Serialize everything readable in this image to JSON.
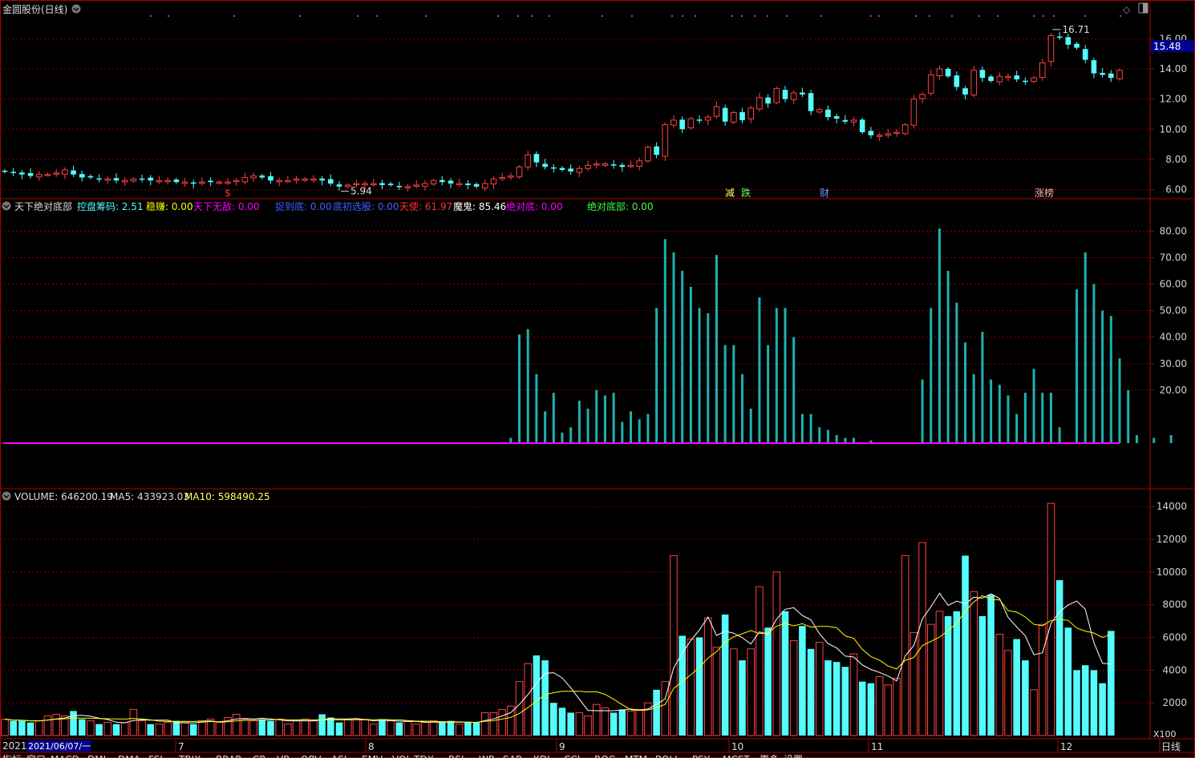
{
  "colors": {
    "up": "#ff4040",
    "down": "#54fcfc",
    "grid": "#8b0000",
    "border": "#b00000",
    "axis_text": "#d0d0d0",
    "line_ma5": "#ffffff",
    "line_ma10": "#ffff00",
    "base_line": "#ff00ff",
    "teal_bar": "#1eb1b1"
  },
  "header": {
    "stock": "金圆股份",
    "period": "(日线)",
    "current_price": "15.48",
    "diamond_icon": "◇"
  },
  "main_panel": {
    "yticks": [
      "16.00",
      "14.00",
      "12.00",
      "10.00",
      "8.00",
      "6.00"
    ],
    "high_label": "16.71",
    "low_label": "5.94",
    "markers": [
      {
        "text": "$",
        "x": 284,
        "color": "#ff3333"
      },
      {
        "text": "减",
        "x": 910,
        "color": "#ffff66"
      },
      {
        "text": "跌",
        "x": 930,
        "color": "#66ff66"
      },
      {
        "text": "财",
        "x": 1028,
        "color": "#6699ff"
      },
      {
        "text": "涨榜",
        "x": 1302,
        "color": "#ffaaaa"
      }
    ]
  },
  "indicator_panel": {
    "title": "天下绝对底部",
    "items": [
      {
        "name": "控盘筹码",
        "value": "2.51",
        "color": "#54fcfc"
      },
      {
        "name": "稳赚",
        "value": "0.00",
        "color": "#ffff00"
      },
      {
        "name": "天下无敌",
        "value": "0.00",
        "color": "#ff00ff"
      },
      {
        "name": "捉到底",
        "value": "0.00",
        "color": "#4060ff"
      },
      {
        "name": "底初选股",
        "value": "0.00",
        "color": "#4060ff"
      },
      {
        "name": "天使",
        "value": "61.97",
        "color": "#ff3030"
      },
      {
        "name": "魔鬼",
        "value": "85.46",
        "color": "#ffffff"
      },
      {
        "name": "绝对底",
        "value": "0.00",
        "color": "#ff00ff"
      },
      {
        "name": "绝对底部",
        "value": "0.00",
        "color": "#40ff40"
      }
    ],
    "yticks": [
      "80.00",
      "70.00",
      "60.00",
      "50.00",
      "40.00",
      "30.00",
      "20.00"
    ]
  },
  "volume_panel": {
    "label": "VOLUME",
    "value": "646200.19",
    "ma5_label": "MA5",
    "ma5_value": "433923.03",
    "ma10_label": "MA10",
    "ma10_value": "598490.25",
    "yticks": [
      "14000",
      "12000",
      "10000",
      "8000",
      "6000",
      "4000",
      "2000"
    ],
    "unit": "X100"
  },
  "time_axis": {
    "labels": [
      "2021",
      "2021/06/07/一",
      "7",
      "8",
      "9",
      "10",
      "11",
      "12"
    ],
    "period_label": "日线"
  },
  "bottom_tabs": [
    "指标",
    "窗口",
    "MACD",
    "DMI",
    "DMA",
    "FSL",
    "TRIX",
    "BRAR",
    "CR",
    "VR",
    "OBV",
    "ASI",
    "EMV",
    "VOL-TDX",
    "RSI",
    "WR",
    "SAR",
    "KDJ",
    "CCI",
    "ROC",
    "MTM",
    "BOLL",
    "PSY",
    "MCST",
    "更多",
    "设置"
  ],
  "chart_data": [
    {
      "type": "candlestick",
      "title": "金圆股份(日线)",
      "x": [
        "2021-06-07",
        "2021-07",
        "2021-08",
        "2021-09",
        "2021-10",
        "2021-11",
        "2021-12"
      ],
      "ylim": [
        5.5,
        17.5
      ],
      "close": [
        7.2,
        7.1,
        7.0,
        6.9,
        7.0,
        7.0,
        7.1,
        7.3,
        7.0,
        6.8,
        6.8,
        6.7,
        6.7,
        6.6,
        6.6,
        6.7,
        6.7,
        6.6,
        6.6,
        6.6,
        6.5,
        6.5,
        6.4,
        6.5,
        6.5,
        6.5,
        6.5,
        6.6,
        6.8,
        6.9,
        6.8,
        6.6,
        6.6,
        6.6,
        6.7,
        6.7,
        6.7,
        6.6,
        6.4,
        6.2,
        6.3,
        6.4,
        6.4,
        6.4,
        6.3,
        6.3,
        6.2,
        6.2,
        6.3,
        6.4,
        6.6,
        6.5,
        6.4,
        6.4,
        6.3,
        6.2,
        6.4,
        6.7,
        6.8,
        6.9,
        7.5,
        8.3,
        7.8,
        7.5,
        7.4,
        7.3,
        7.2,
        7.4,
        7.6,
        7.7,
        7.7,
        7.6,
        7.5,
        7.6,
        7.9,
        8.8,
        8.3,
        10.3,
        10.6,
        10.0,
        10.7,
        10.6,
        10.8,
        11.5,
        10.5,
        11.1,
        10.6,
        11.4,
        12.1,
        11.7,
        12.7,
        12.0,
        12.4,
        12.3,
        11.2,
        11.3,
        10.8,
        10.7,
        10.5,
        10.6,
        9.8,
        9.6,
        9.6,
        9.7,
        9.8,
        10.3,
        12.0,
        12.3,
        13.6,
        14.0,
        13.5,
        12.8,
        12.3,
        13.9,
        13.4,
        13.2,
        13.5,
        13.5,
        13.3,
        13.2,
        13.4,
        14.4,
        16.2,
        16.1,
        15.6,
        15.4,
        14.6,
        13.7,
        13.6,
        13.4,
        13.9
      ],
      "note": "closing prices read from the candlestick chart"
    },
    {
      "type": "bar",
      "title": "天下绝对底部",
      "ylim": [
        0,
        88
      ],
      "values": [
        0,
        0,
        0,
        0,
        0,
        0,
        0,
        0,
        0,
        0,
        0,
        0,
        0,
        0,
        0,
        0,
        0,
        0,
        0,
        0,
        0,
        0,
        0,
        0,
        0,
        0,
        0,
        0,
        0,
        0,
        0,
        0,
        0,
        0,
        0,
        0,
        0,
        0,
        0,
        0,
        0,
        0,
        0,
        0,
        0,
        0,
        0,
        0,
        0,
        0,
        0,
        0,
        0,
        0,
        0,
        0,
        0,
        0,
        0,
        2,
        41,
        43,
        26,
        12,
        19,
        4,
        6,
        16,
        13,
        20,
        18,
        19,
        8,
        12,
        9,
        11,
        51,
        77,
        72,
        65,
        59,
        51,
        49,
        71,
        37,
        37,
        26,
        13,
        55,
        37,
        51,
        51,
        40,
        11,
        11,
        6,
        5,
        3,
        2,
        2,
        0,
        1,
        0,
        0,
        0,
        0,
        0,
        24,
        51,
        81,
        65,
        53,
        38,
        26,
        42,
        24,
        22,
        18,
        11,
        19,
        28,
        19,
        19,
        6,
        0,
        58,
        72,
        60,
        50,
        48,
        32,
        20,
        3,
        0,
        2,
        0,
        3
      ],
      "note": "teal bars above the magenta baseline"
    },
    {
      "type": "bar",
      "title": "VOLUME",
      "ylim": [
        0,
        14500
      ],
      "values": [
        1000,
        900,
        900,
        800,
        900,
        1200,
        1300,
        1200,
        1500,
        1000,
        900,
        700,
        800,
        700,
        800,
        1600,
        900,
        700,
        700,
        800,
        900,
        800,
        700,
        900,
        1000,
        800,
        1100,
        1300,
        1000,
        900,
        1000,
        900,
        1000,
        700,
        900,
        1000,
        900,
        1300,
        1100,
        800,
        1000,
        1000,
        1000,
        700,
        1000,
        900,
        800,
        900,
        700,
        800,
        900,
        800,
        900,
        700,
        800,
        800,
        1400,
        1400,
        1600,
        1800,
        3300,
        4400,
        4900,
        4600,
        2000,
        1700,
        1400,
        1400,
        1200,
        1900,
        1700,
        1400,
        1600,
        1500,
        1600,
        2000,
        2800,
        3300,
        11000,
        6100,
        5900,
        6000,
        7200,
        5400,
        7400,
        5300,
        4600,
        5300,
        9100,
        6600,
        10000,
        7600,
        5800,
        6700,
        5300,
        5700,
        4600,
        4500,
        4200,
        5000,
        3300,
        3200,
        3600,
        3100,
        3500,
        11000,
        6300,
        11800,
        6800,
        7600,
        7300,
        7600,
        11000,
        8800,
        7300,
        8600,
        6200,
        5200,
        5900,
        4600,
        2800,
        6800,
        14200,
        9500,
        6600,
        4000,
        4300,
        4000,
        3200,
        6400
      ],
      "ma5_note": "white line",
      "ma10_note": "yellow line"
    }
  ]
}
